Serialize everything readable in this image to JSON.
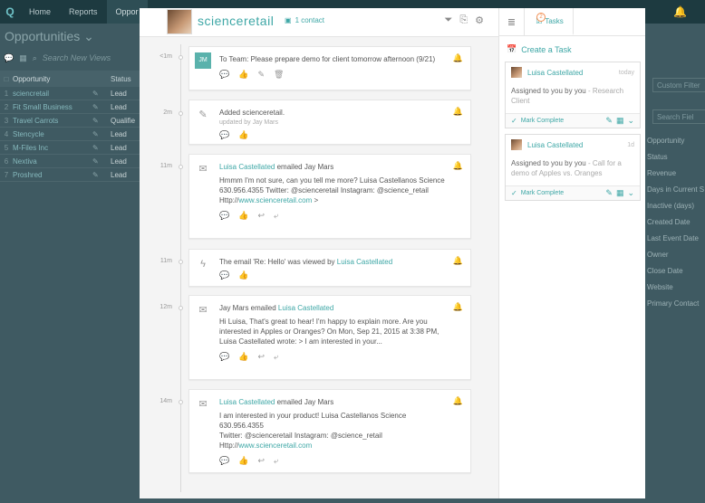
{
  "nav": {
    "logo": "Q",
    "items": [
      "Home",
      "Reports",
      "Oppor"
    ]
  },
  "page": {
    "title": "Opportunities",
    "search_placeholder": "Search New Views"
  },
  "bg_table": {
    "col_opportunity": "Opportunity",
    "col_status": "Status",
    "rows": [
      {
        "num": "1",
        "name": "sciencretail",
        "status": "Lead"
      },
      {
        "num": "2",
        "name": "Fit Small Business",
        "status": "Lead"
      },
      {
        "num": "3",
        "name": "Travel Carrots",
        "status": "Qualifie"
      },
      {
        "num": "4",
        "name": "Stencycle",
        "status": "Lead"
      },
      {
        "num": "5",
        "name": "M-Files Inc",
        "status": "Lead"
      },
      {
        "num": "6",
        "name": "Nextiva",
        "status": "Lead"
      },
      {
        "num": "7",
        "name": "Proshred",
        "status": "Lead"
      }
    ]
  },
  "right_panel": {
    "filter1": "Custom Filter",
    "filter2": "Search Fiel",
    "fields": [
      "Opportunity",
      "Status",
      "Revenue",
      "Days in Current S",
      "Inactive (days)",
      "Created Date",
      "Last Event Date",
      "Owner",
      "Close Date",
      "Website",
      "Primary Contact"
    ]
  },
  "modal": {
    "name": "scienceretail",
    "contact_count": "1 contact",
    "entries": [
      {
        "time": "<1m",
        "type": "note",
        "icon_text": "JM",
        "text": "To Team: Please prepare demo for client tomorrow afternoon (9/21)"
      },
      {
        "time": "2m",
        "type": "edit",
        "text": "Added scienceretail.",
        "sub": "updated by Jay Mars"
      },
      {
        "time": "11m",
        "type": "email",
        "from": "Luisa Castellated",
        "verb": "emailed Jay Mars",
        "body": "Hmmm I'm not sure, can you tell me more? Luisa Castellanos Science 630.956.4355 Twitter: @scienceretail Instagram: @science_retail Http://",
        "link": "www.scienceretail.com",
        "tail": " >"
      },
      {
        "time": "11m",
        "type": "viewed",
        "text": "The email 'Re: Hello' was viewed by ",
        "link": "Luisa Castellated"
      },
      {
        "time": "12m",
        "type": "email",
        "from_plain": "Jay Mars emailed ",
        "to_link": "Luisa Castellated",
        "body": "Hi Luisa, That's great to hear! I'm happy to explain more. Are you interested in Apples or Oranges? On Mon, Sep 21, 2015 at 3:38 PM, Luisa Castellated wrote: > I am interested in your..."
      },
      {
        "time": "14m",
        "type": "email",
        "from": "Luisa Castellated",
        "verb": "emailed Jay Mars",
        "body1": "I am interested in your product! Luisa Castellanos Science 630.956.4355",
        "body2": "Twitter: @scienceretail Instagram: @science_retail",
        "body3": "Http://",
        "link": "www.scienceretail.com"
      }
    ]
  },
  "tasks": {
    "tab_label": "Tasks",
    "badge": "2",
    "create_label": "Create a Task",
    "items": [
      {
        "name": "Luisa Castellated",
        "when": "today",
        "assigned": "Assigned to you by you",
        "desc": " - Research Client",
        "mark": "Mark Complete"
      },
      {
        "name": "Luisa Castellated",
        "when": "1d",
        "assigned": "Assigned to you by you",
        "desc": " - Call for a demo of Apples vs. Oranges",
        "mark": "Mark Complete"
      }
    ]
  },
  "colors": {
    "accent": "#3ea7a6",
    "bell": "#f28c4e"
  }
}
